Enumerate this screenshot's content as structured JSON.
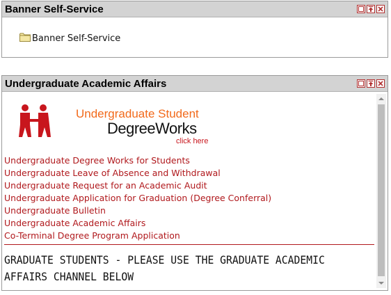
{
  "channels": [
    {
      "title": "Banner Self-Service",
      "folder_label": "Banner Self-Service"
    },
    {
      "title": "Undergraduate Academic Affairs",
      "logo": {
        "line1": "Undergraduate Student",
        "line2": "DegreeWorks",
        "line3": "click here"
      },
      "links": [
        "Undergraduate Degree Works for Students",
        "Undergraduate Leave of Absence and Withdrawal",
        "Undergraduate Request for an Academic Audit",
        "Undergraduate Application for Graduation (Degree Conferral)",
        "Undergraduate Bulletin",
        "Undergraduate Academic Affairs",
        "Co-Terminal Degree Program Application"
      ],
      "notice": "GRADUATE STUDENTS - PLEASE USE THE GRADUATE ACADEMIC AFFAIRS CHANNEL BELOW"
    }
  ],
  "colors": {
    "link": "#b0181c",
    "logo_orange": "#f26a1b",
    "header_bg": "#d3d3d3"
  }
}
